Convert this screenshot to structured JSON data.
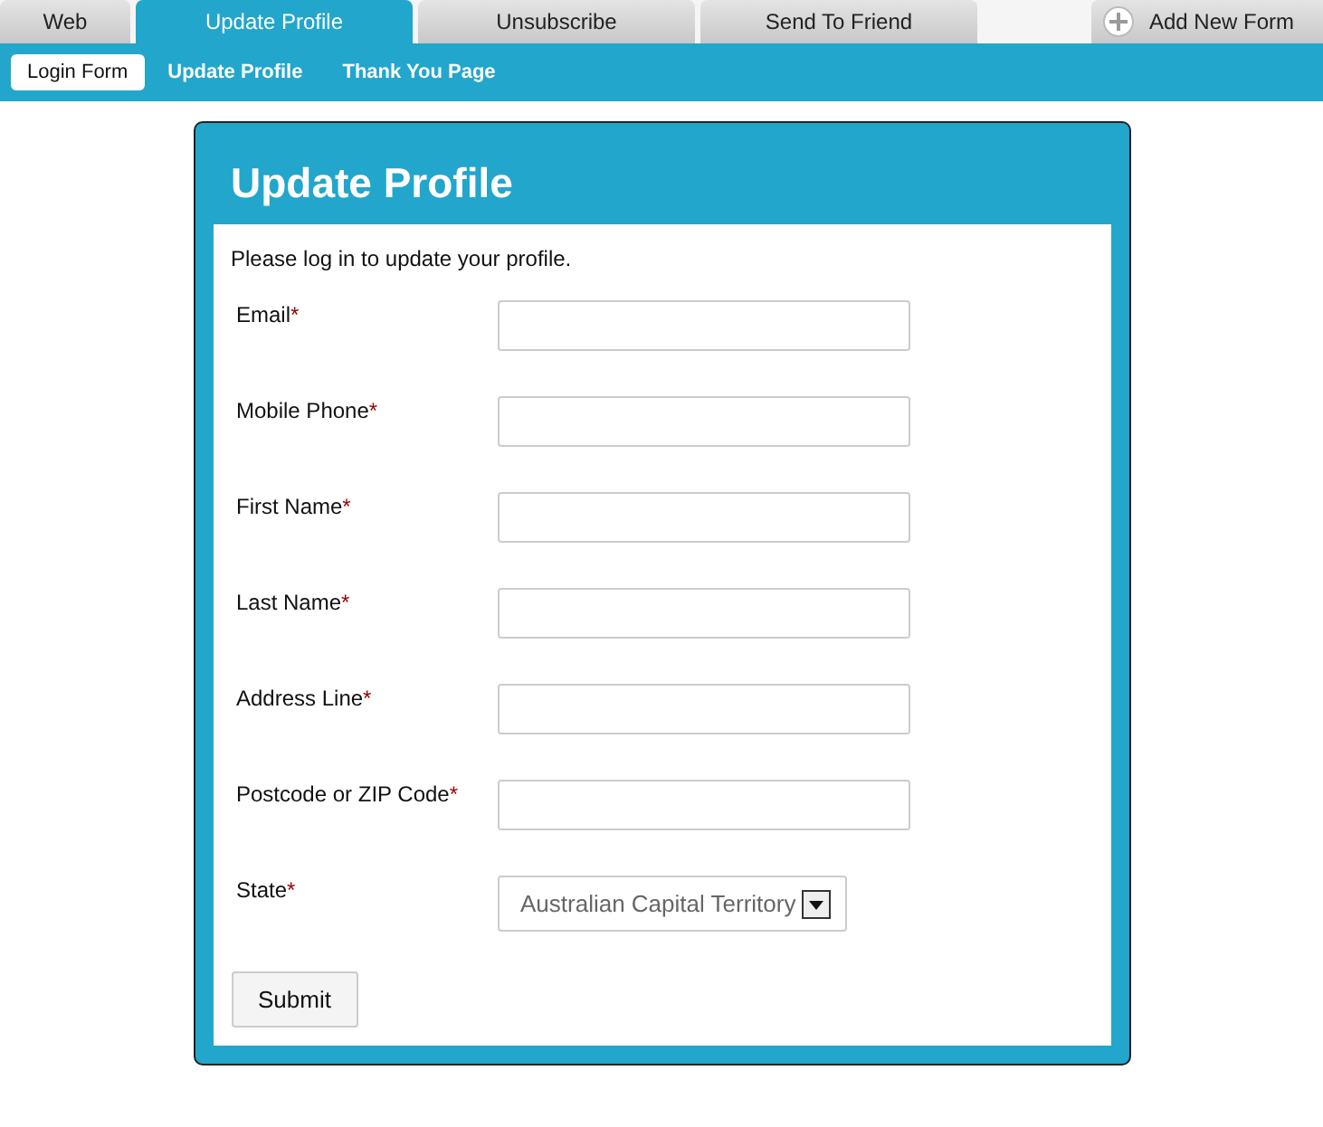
{
  "tabs": [
    {
      "label": "Web",
      "selected": false
    },
    {
      "label": "Update Profile",
      "selected": true
    },
    {
      "label": "Unsubscribe",
      "selected": false
    },
    {
      "label": "Send To Friend",
      "selected": false
    }
  ],
  "add_button": {
    "label": "Add New Form"
  },
  "subtabs": [
    {
      "label": "Login Form",
      "selected": true
    },
    {
      "label": "Update Profile",
      "selected": false
    },
    {
      "label": "Thank You Page",
      "selected": false
    }
  ],
  "form": {
    "title": "Update Profile",
    "intro": "Please log in to update your profile.",
    "fields": [
      {
        "kind": "text",
        "label": "Email",
        "marker": "*"
      },
      {
        "kind": "text",
        "label": "Mobile Phone",
        "marker": "*"
      },
      {
        "kind": "text",
        "label": "First Name",
        "marker": "*"
      },
      {
        "kind": "text",
        "label": "Last Name",
        "marker": "*"
      },
      {
        "kind": "text",
        "label": "Address Line",
        "marker": "*"
      },
      {
        "kind": "text",
        "label": "Postcode or ZIP Code",
        "marker": "*"
      },
      {
        "kind": "select",
        "label": "State",
        "marker": "*",
        "value": "Australian Capital Territory"
      }
    ],
    "submit": "Submit"
  }
}
